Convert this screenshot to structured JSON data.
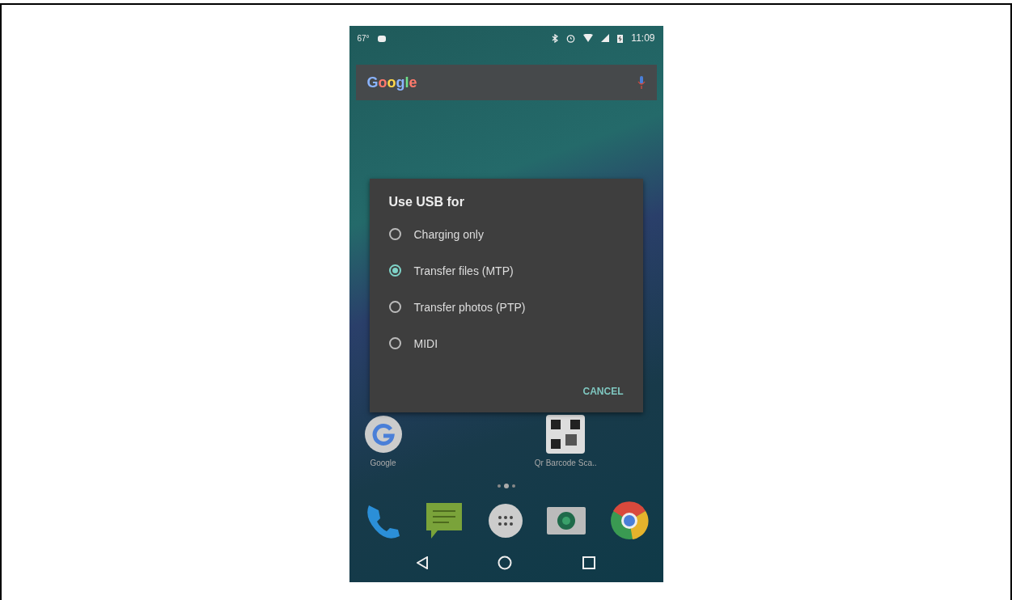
{
  "status_bar": {
    "temperature": "67°",
    "time": "11:09"
  },
  "search_bar": {
    "logo": "Google"
  },
  "home_apps": [
    {
      "kind": "google",
      "label": "Google"
    },
    {
      "kind": "qr",
      "label": "Qr Barcode Sca.."
    }
  ],
  "page_dots": [
    {
      "selected": false
    },
    {
      "selected": true
    },
    {
      "selected": false
    }
  ],
  "dock": [
    {
      "kind": "phone"
    },
    {
      "kind": "messages"
    },
    {
      "kind": "apps"
    },
    {
      "kind": "camera"
    },
    {
      "kind": "browser"
    }
  ],
  "dialog": {
    "title": "Use USB for",
    "options": [
      {
        "label": "Charging only",
        "selected": false
      },
      {
        "label": "Transfer files (MTP)",
        "selected": true
      },
      {
        "label": "Transfer photos (PTP)",
        "selected": false
      },
      {
        "label": "MIDI",
        "selected": false
      }
    ],
    "buttons": [
      "CANCEL"
    ]
  }
}
